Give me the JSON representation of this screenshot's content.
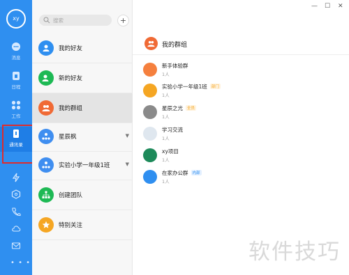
{
  "rail": {
    "avatar": "xy",
    "items": [
      {
        "label": "消息",
        "icon": "chat-icon"
      },
      {
        "label": "日程",
        "icon": "calendar-icon"
      },
      {
        "label": "工作",
        "icon": "apps-grid-icon"
      },
      {
        "label": "通讯录",
        "icon": "contacts-icon"
      }
    ],
    "extra_icons": [
      "lightning-icon",
      "cube-icon",
      "phone-icon",
      "cloud-icon",
      "mail-icon"
    ],
    "more": "• • •"
  },
  "middle": {
    "search_placeholder": "搜索",
    "add_label": "+",
    "items": [
      {
        "label": "我的好友",
        "icon": "user-icon",
        "color": "#2f8ff0"
      },
      {
        "label": "新的好友",
        "icon": "add-user-icon",
        "color": "#1db954"
      },
      {
        "label": "我的群组",
        "icon": "group-icon",
        "color": "#f06a35"
      },
      {
        "label": "星辰枫",
        "icon": "org-icon",
        "color": "#3f8ef0"
      },
      {
        "label": "实验小学一年级1班",
        "icon": "org-icon",
        "color": "#3f8ef0"
      },
      {
        "label": "创建团队",
        "icon": "org-tree-icon",
        "color": "#1db954"
      },
      {
        "label": "特别关注",
        "icon": "star-icon",
        "color": "#f5a623"
      }
    ]
  },
  "right": {
    "window": {
      "minimize": "—",
      "maximize": "☐",
      "close": "✕"
    },
    "title": "我的群组",
    "groups": [
      {
        "name": "新手体验群",
        "count": "1人",
        "tag": "",
        "color": "#f5803e"
      },
      {
        "name": "实验小学一年级1班",
        "count": "1人",
        "tag": "部门",
        "color": "#f5a623"
      },
      {
        "name": "星辰之光",
        "count": "1人",
        "tag": "全员",
        "color": "#8a8a8a"
      },
      {
        "name": "学习交流",
        "count": "1人",
        "tag": "",
        "color": "#dfe7ef"
      },
      {
        "name": "xy项目",
        "count": "1人",
        "tag": "",
        "color": "#1d8a5a"
      },
      {
        "name": "在家办公群",
        "count": "1人",
        "tag": "内部",
        "color": "#2f8ff0"
      }
    ]
  },
  "watermark": "软件技巧"
}
